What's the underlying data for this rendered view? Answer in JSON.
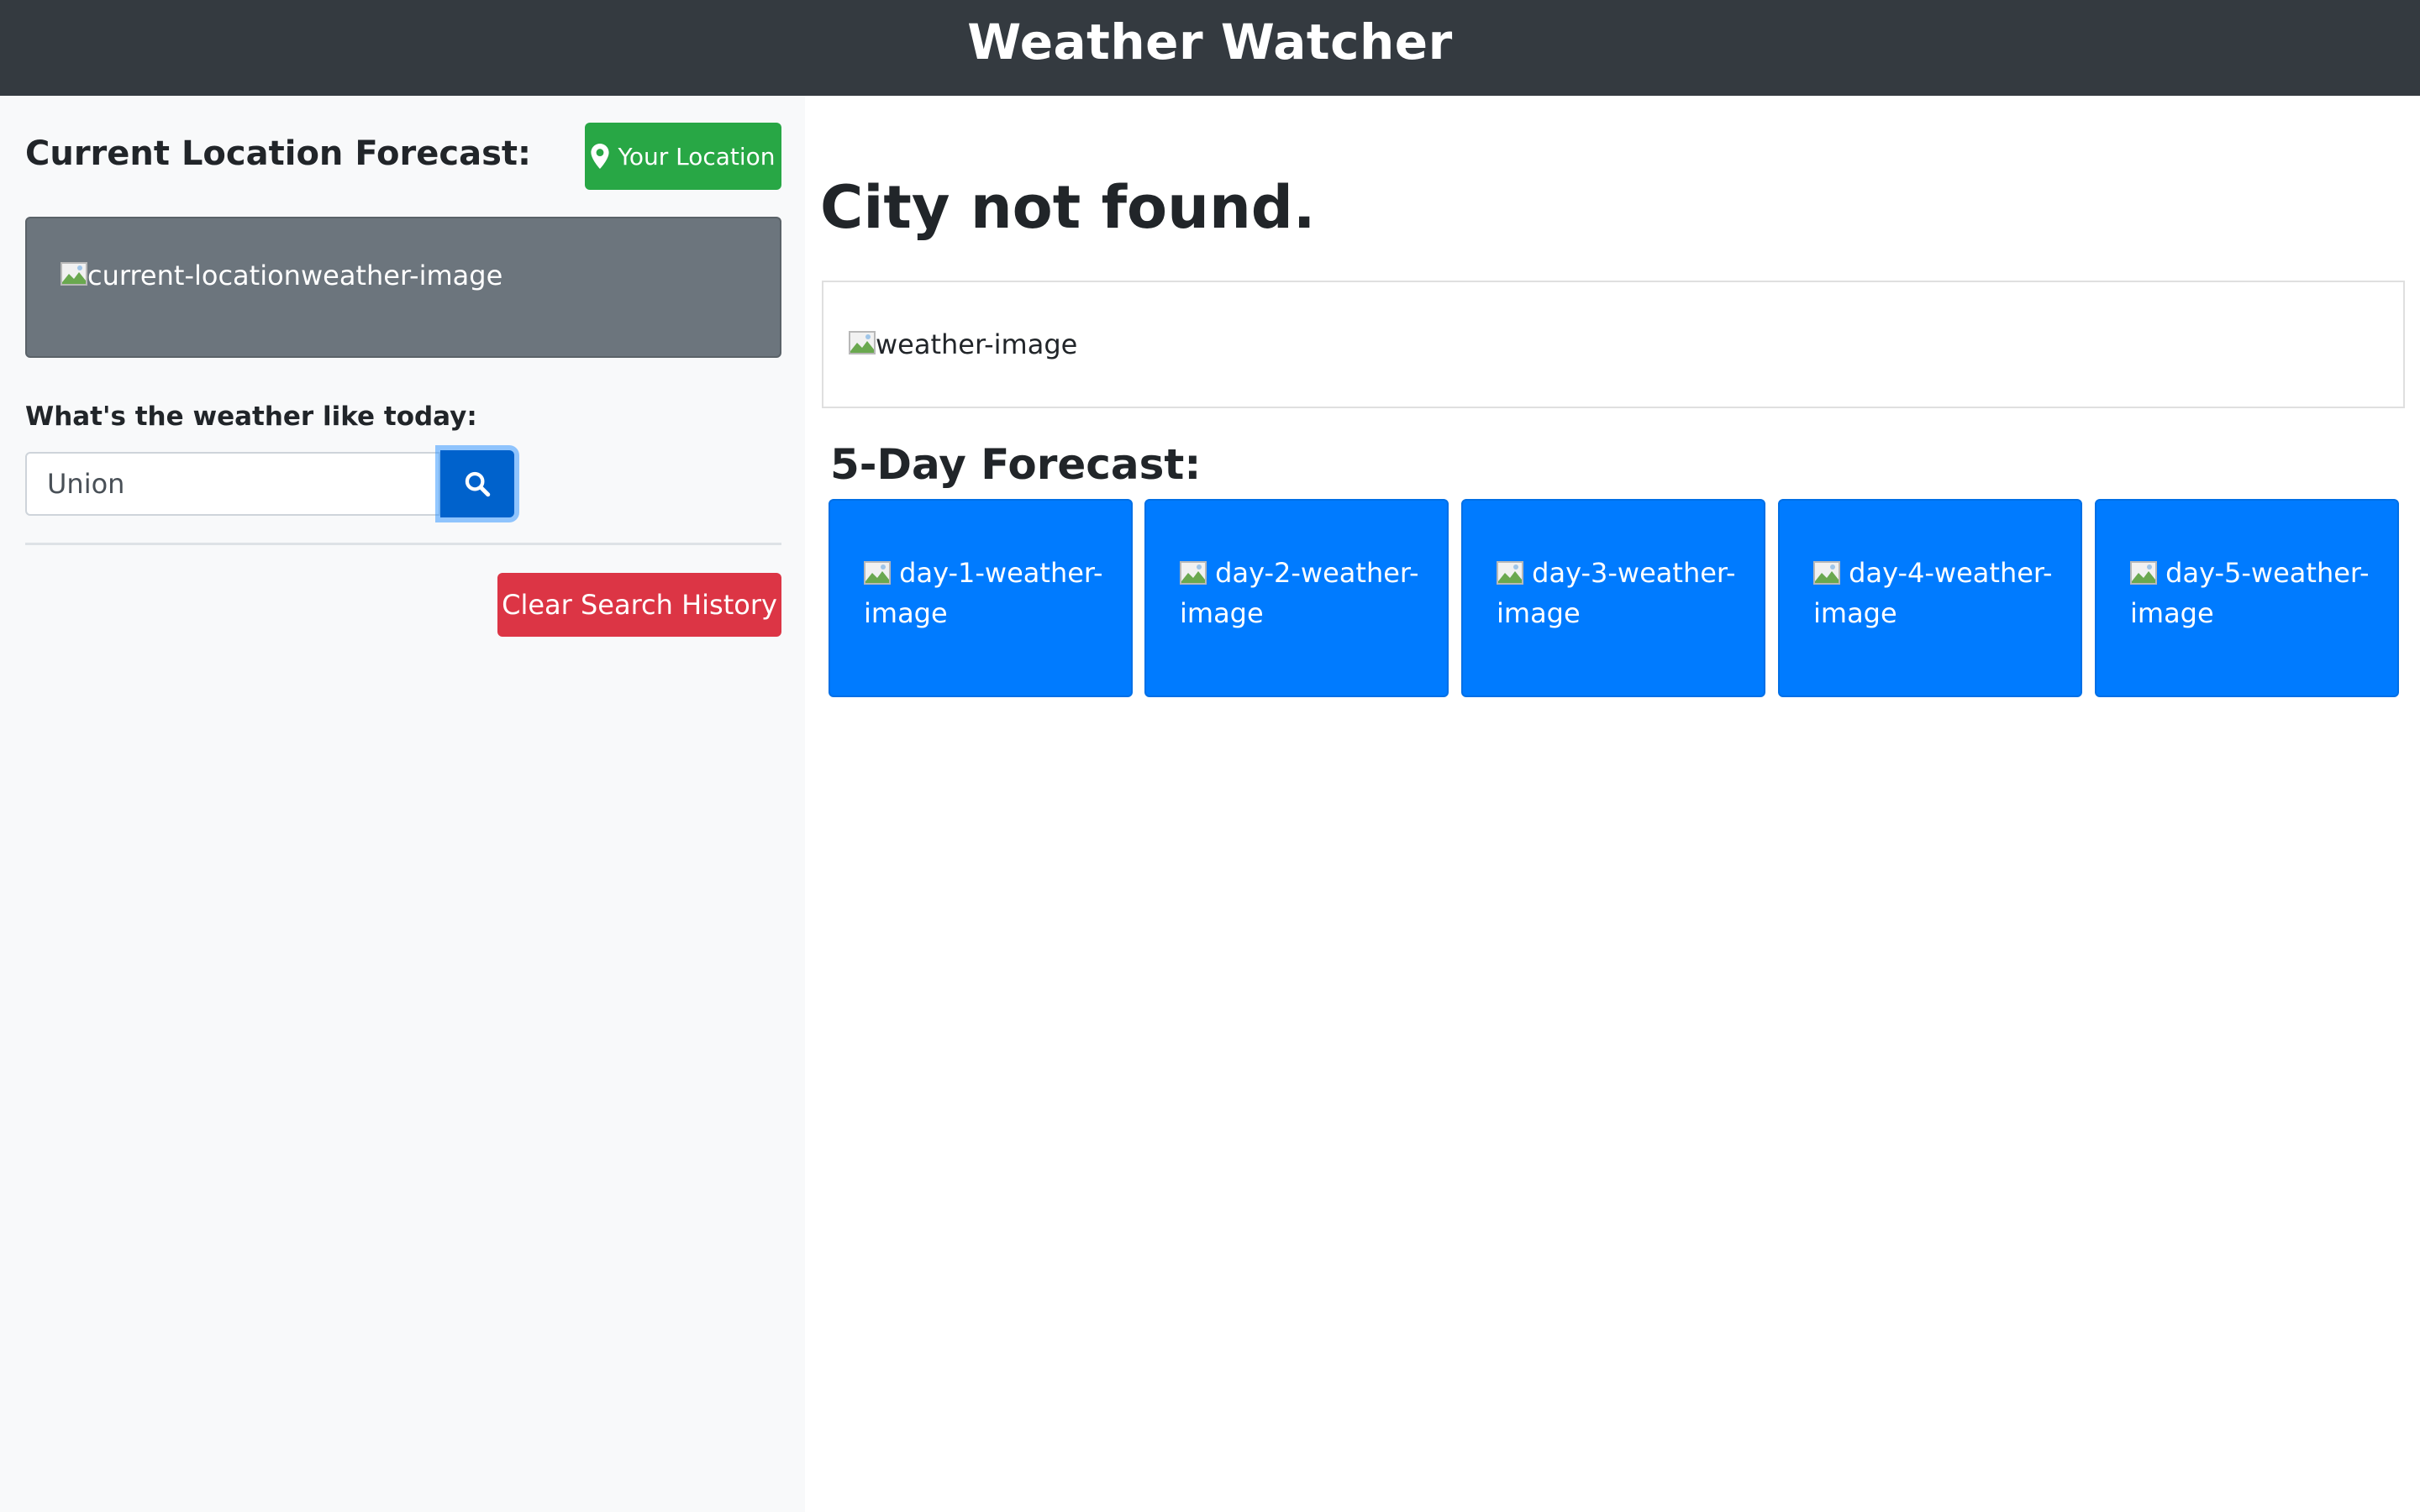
{
  "header": {
    "title": "Weather Watcher"
  },
  "sidebar": {
    "current_location_title": "Current Location Forecast:",
    "your_location_label": "Your Location",
    "current_location_image_alt": "current-locationweather-image",
    "search_label": "What's the weather like today:",
    "search_value": "Union",
    "clear_history_label": "Clear Search History"
  },
  "main": {
    "city_title": "City not found.",
    "weather_image_alt": "weather-image",
    "forecast_title": "5-Day Forecast:",
    "days": [
      {
        "image_alt": "day-1-weather-image"
      },
      {
        "image_alt": "day-2-weather-image"
      },
      {
        "image_alt": "day-3-weather-image"
      },
      {
        "image_alt": "day-4-weather-image"
      },
      {
        "image_alt": "day-5-weather-image"
      }
    ]
  },
  "colors": {
    "header_bg": "#343a40",
    "success": "#28a745",
    "secondary": "#6c757d",
    "primary": "#007bff",
    "danger": "#dc3545"
  },
  "icons": {
    "location": "map-marker-icon",
    "search": "magnifier-icon",
    "broken_image": "broken-image-icon"
  }
}
